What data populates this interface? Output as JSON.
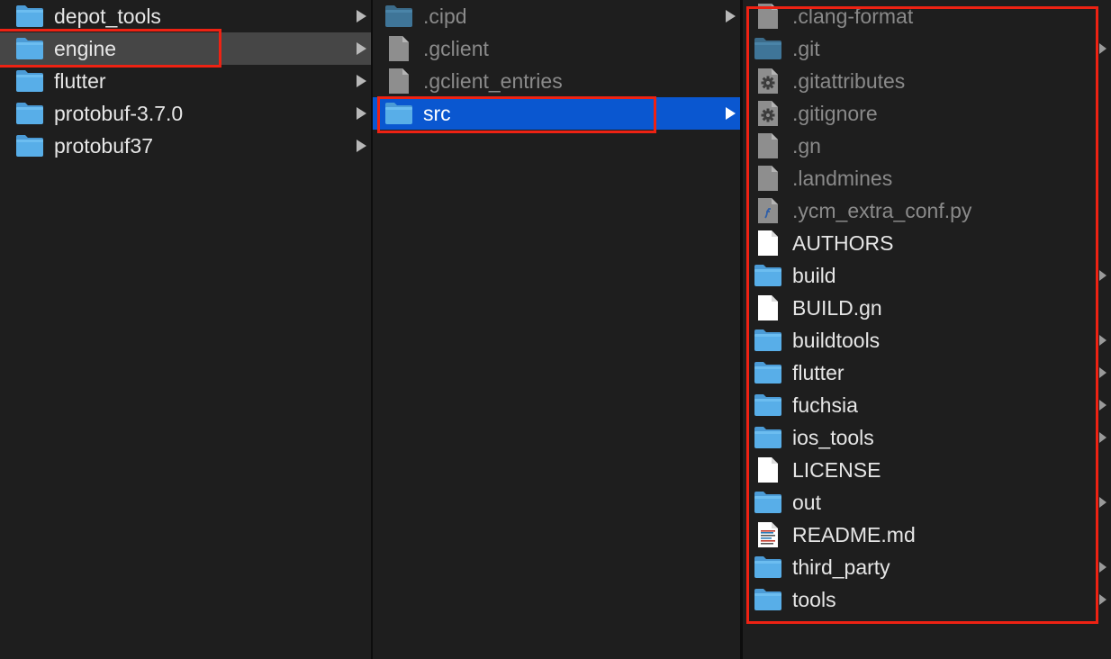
{
  "columns": [
    {
      "items": [
        {
          "name": "depot_tools",
          "kind": "folder",
          "has_children": true,
          "hidden": false,
          "state": ""
        },
        {
          "name": "engine",
          "kind": "folder",
          "has_children": true,
          "hidden": false,
          "state": "selected-inactive"
        },
        {
          "name": "flutter",
          "kind": "folder",
          "has_children": true,
          "hidden": false,
          "state": ""
        },
        {
          "name": "protobuf-3.7.0",
          "kind": "folder",
          "has_children": true,
          "hidden": false,
          "state": ""
        },
        {
          "name": "protobuf37",
          "kind": "folder",
          "has_children": true,
          "hidden": false,
          "state": ""
        }
      ]
    },
    {
      "items": [
        {
          "name": ".cipd",
          "kind": "folder",
          "has_children": true,
          "hidden": true,
          "state": ""
        },
        {
          "name": ".gclient",
          "kind": "file",
          "has_children": false,
          "hidden": true,
          "state": ""
        },
        {
          "name": ".gclient_entries",
          "kind": "file",
          "has_children": false,
          "hidden": true,
          "state": ""
        },
        {
          "name": "src",
          "kind": "folder",
          "has_children": true,
          "hidden": false,
          "state": "selected-active"
        }
      ]
    },
    {
      "items": [
        {
          "name": ".clang-format",
          "kind": "file",
          "has_children": false,
          "hidden": true,
          "state": ""
        },
        {
          "name": ".git",
          "kind": "folder",
          "has_children": true,
          "hidden": true,
          "state": ""
        },
        {
          "name": ".gitattributes",
          "kind": "settings-file",
          "has_children": false,
          "hidden": true,
          "state": ""
        },
        {
          "name": ".gitignore",
          "kind": "settings-file",
          "has_children": false,
          "hidden": true,
          "state": ""
        },
        {
          "name": ".gn",
          "kind": "file",
          "has_children": false,
          "hidden": true,
          "state": ""
        },
        {
          "name": ".landmines",
          "kind": "file",
          "has_children": false,
          "hidden": true,
          "state": ""
        },
        {
          "name": ".ycm_extra_conf.py",
          "kind": "python-file",
          "has_children": false,
          "hidden": true,
          "state": ""
        },
        {
          "name": "AUTHORS",
          "kind": "file",
          "has_children": false,
          "hidden": false,
          "state": ""
        },
        {
          "name": "build",
          "kind": "folder",
          "has_children": true,
          "hidden": false,
          "state": ""
        },
        {
          "name": "BUILD.gn",
          "kind": "file",
          "has_children": false,
          "hidden": false,
          "state": ""
        },
        {
          "name": "buildtools",
          "kind": "folder",
          "has_children": true,
          "hidden": false,
          "state": ""
        },
        {
          "name": "flutter",
          "kind": "folder",
          "has_children": true,
          "hidden": false,
          "state": ""
        },
        {
          "name": "fuchsia",
          "kind": "folder",
          "has_children": true,
          "hidden": false,
          "state": ""
        },
        {
          "name": "ios_tools",
          "kind": "folder",
          "has_children": true,
          "hidden": false,
          "state": ""
        },
        {
          "name": "LICENSE",
          "kind": "file",
          "has_children": false,
          "hidden": false,
          "state": ""
        },
        {
          "name": "out",
          "kind": "folder",
          "has_children": true,
          "hidden": false,
          "state": ""
        },
        {
          "name": "README.md",
          "kind": "markdown-file",
          "has_children": false,
          "hidden": false,
          "state": ""
        },
        {
          "name": "third_party",
          "kind": "folder",
          "has_children": true,
          "hidden": false,
          "state": ""
        },
        {
          "name": "tools",
          "kind": "folder",
          "has_children": true,
          "hidden": false,
          "state": ""
        }
      ]
    }
  ],
  "colors": {
    "background": "#1e1e1e",
    "selection_active": "#0a57d0",
    "selection_inactive": "#464646",
    "annotation_red": "#ee2213",
    "folder_blue": "#58aee8",
    "hidden_text": "#8a8a8a"
  }
}
